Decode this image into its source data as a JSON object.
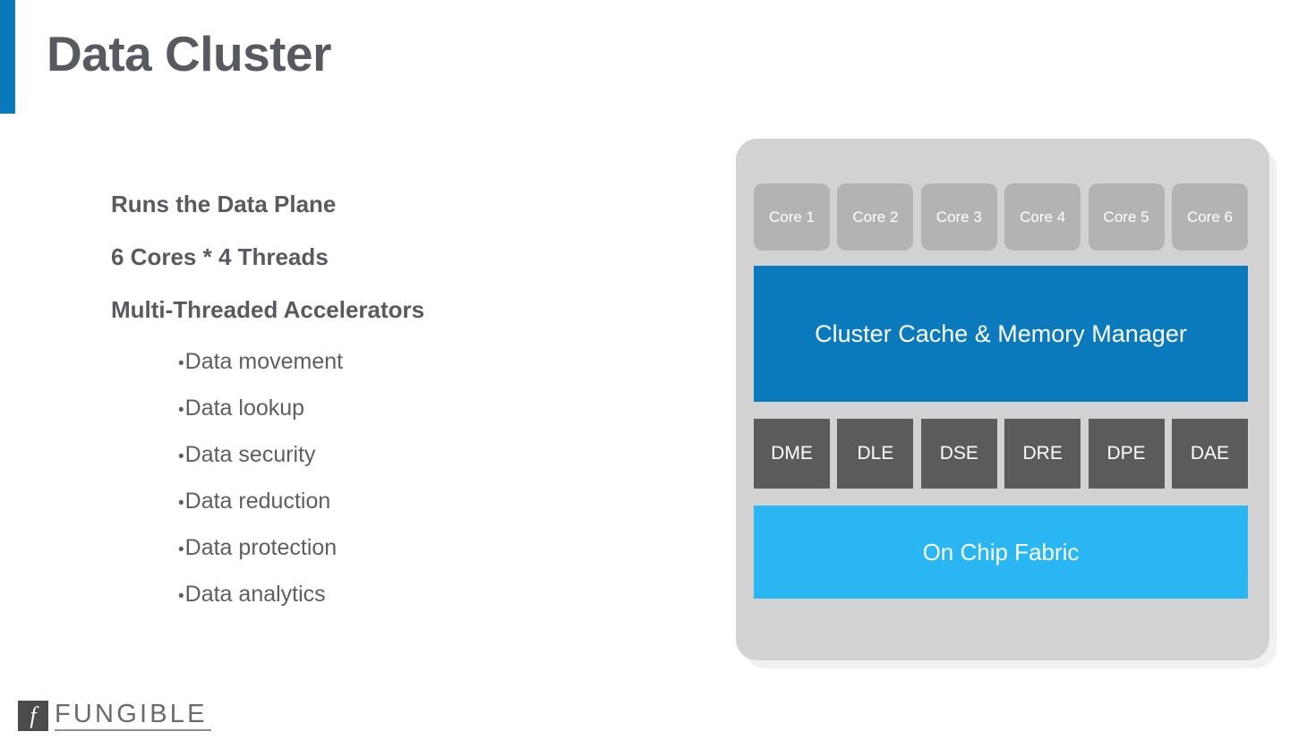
{
  "slide": {
    "title": "Data Cluster",
    "accent_color": "#0a78bd",
    "title_color": "#585a62",
    "background": "#ffffff"
  },
  "content": {
    "lead_lines": [
      "Runs the Data Plane",
      "6 Cores * 4 Threads",
      "Multi-Threaded Accelerators"
    ],
    "bullet_glyph": "•",
    "bullets": [
      "Data movement",
      "Data lookup",
      "Data security",
      "Data reduction",
      "Data protection",
      "Data analytics"
    ]
  },
  "diagram": {
    "container_color": "#d2d2d2",
    "cores": [
      "Core 1",
      "Core 2",
      "Core 3",
      "Core 4",
      "Core 5",
      "Core 6"
    ],
    "core_color": "#b3b3b3",
    "cache_band": {
      "label": "Cluster Cache & Memory Manager",
      "color": "#0b7abd"
    },
    "accelerators": [
      "DME",
      "DLE",
      "DSE",
      "DRE",
      "DPE",
      "DAE"
    ],
    "accelerator_color": "#5b5b5b",
    "fabric_band": {
      "label": "On Chip Fabric",
      "color": "#29b6f2"
    }
  },
  "logo": {
    "mark": "f",
    "wordmark": "FUNGIBLE"
  }
}
